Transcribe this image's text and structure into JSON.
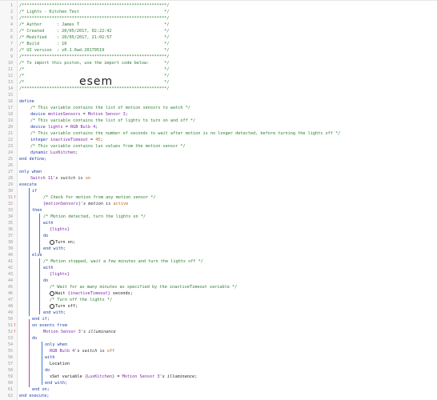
{
  "header_lines": [
    "/**********************************************************/",
    "/* Lights - Kitchen Test                                  */",
    "/**********************************************************/",
    "/* Author      : James T                                  */",
    "/* Created     : 20/05/2017, 02:22:42                     */",
    "/* Modified    : 20/05/2017, 21:02:57                     */",
    "/* Build       : 10                                       */",
    "/* UI version  : v0.1.0ad.20170519                        */",
    "/**********************************************************/",
    "/* To import this piston, use the import code below:      */",
    "/*                                                        */",
    "/*                                                        */",
    "/*                                                        */",
    "/**********************************************************/"
  ],
  "import_code": "esem",
  "code": {
    "define": "define",
    "c1": "/* This variable contains the list of motion sensors to watch */",
    "d1_kw": "device",
    "d1_name": "motionSensors",
    "d1_eq": " = ",
    "d1_val": "Motion Sensor 3",
    "c2": "/* This variable contains the list of lights to turn on and off */",
    "d2_kw": "device",
    "d2_name": "lights",
    "d2_val": "RGB Bulb 4",
    "c3": "/* This variable contains the number of seconds to wait after motion is no longer detected, before turning the lights off */",
    "d3_kw": "integer",
    "d3_name": "inactiveTimeout",
    "d3_val": "45",
    "c4": "/* This variable contains lux values from the motion sensor */",
    "d4_kw": "dynamic",
    "d4_name": "LuxKitchen",
    "end_define": "end define;",
    "only_when": "only when",
    "switch_dev": "Switch 11",
    "switch_attr": "'s switch",
    "is": " is ",
    "on": "on",
    "execute": "execute",
    "if": "if",
    "c5": "/* Check for motion from any motion sensor */",
    "motion_var": "{motionSensors}",
    "motion_attr": "'s motion",
    "active": "active",
    "then": "then",
    "c6": "/* Motion detected, turn the lights on */",
    "with": "with",
    "lights_var": "{lights}",
    "do": "do",
    "turn_on": "Turn on;",
    "end_with": "end with;",
    "else": "else",
    "c7": "/* Motion stopped, wait a few minutes and turn the lights off */",
    "c8": "/* Wait for as many minutes as specified by the inactiveTimeout variable */",
    "wait": "Wait ",
    "wait_var": "{inactiveTimeout}",
    "seconds": " seconds;",
    "c9": "/* Turn off the lights */",
    "turn_off": "Turn off;",
    "end_if": "end if;",
    "on_events": "on events from",
    "motion_dev": "Motion Sensor 3",
    "illum": "'s illuminance",
    "rgb_dev": "RGB Bulb 4",
    "off": "off",
    "location": "Location",
    "set_var": "Set variable ",
    "lux_var": "{LuxKitchen}",
    "end_on": "end on;",
    "end_execute": "end execute;"
  },
  "line_numbers": [
    "1",
    "2",
    "3",
    "4",
    "5",
    "6",
    "7",
    "8",
    "9",
    "10",
    "11",
    "12",
    "13",
    "14",
    "15",
    "16",
    "17",
    "18",
    "19",
    "20",
    "21",
    "22",
    "23",
    "24",
    "25",
    "26",
    "27",
    "28",
    "29",
    "30",
    "31",
    "32",
    "33",
    "34",
    "35",
    "36",
    "37",
    "38",
    "39",
    "40",
    "41",
    "42",
    "43",
    "44",
    "45",
    "46",
    "47",
    "48",
    "49",
    "50",
    "51",
    "52",
    "53",
    "54",
    "55",
    "56",
    "57",
    "58",
    "59",
    "60",
    "61",
    "62"
  ],
  "colors": {
    "comment": "#2e7d32",
    "keyword": "#1f3ea8",
    "device": "#7a2aa8",
    "value": "#b5651d",
    "error_marker": "#d02020"
  },
  "icons": {
    "turn_on": "power-icon",
    "wait": "clock-icon",
    "turn_off": "power-icon",
    "set_variable": "variable-icon"
  }
}
